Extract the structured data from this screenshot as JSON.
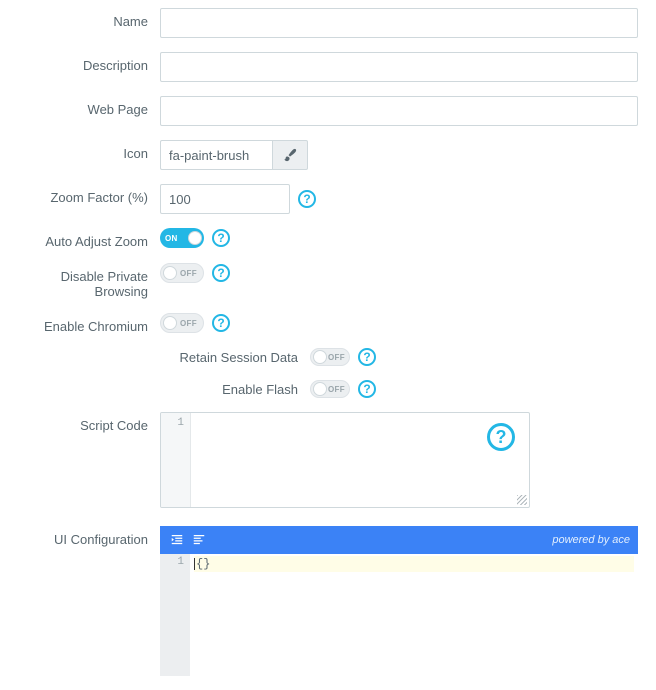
{
  "fields": {
    "name": {
      "label": "Name",
      "value": ""
    },
    "description": {
      "label": "Description",
      "value": ""
    },
    "webpage": {
      "label": "Web Page",
      "value": ""
    },
    "icon": {
      "label": "Icon",
      "value": "fa-paint-brush",
      "picker_icon": "paint-brush-icon"
    },
    "zoom": {
      "label": "Zoom Factor (%)",
      "value": "100"
    },
    "auto_adjust": {
      "label": "Auto Adjust Zoom",
      "on": true,
      "on_text": "ON",
      "off_text": "OFF"
    },
    "disable_private": {
      "label": "Disable Private Browsing",
      "on": false,
      "on_text": "ON",
      "off_text": "OFF"
    },
    "enable_chromium": {
      "label": "Enable Chromium",
      "on": false,
      "on_text": "ON",
      "off_text": "OFF"
    },
    "retain_session": {
      "label": "Retain Session Data",
      "on": false,
      "on_text": "ON",
      "off_text": "OFF"
    },
    "enable_flash": {
      "label": "Enable Flash",
      "on": false,
      "on_text": "ON",
      "off_text": "OFF"
    },
    "script": {
      "label": "Script Code",
      "gutter1": "1"
    },
    "ui_config": {
      "label": "UI Configuration",
      "gutter1": "1",
      "content": "{}",
      "powered": "powered by ace"
    }
  },
  "help_glyph": "?"
}
